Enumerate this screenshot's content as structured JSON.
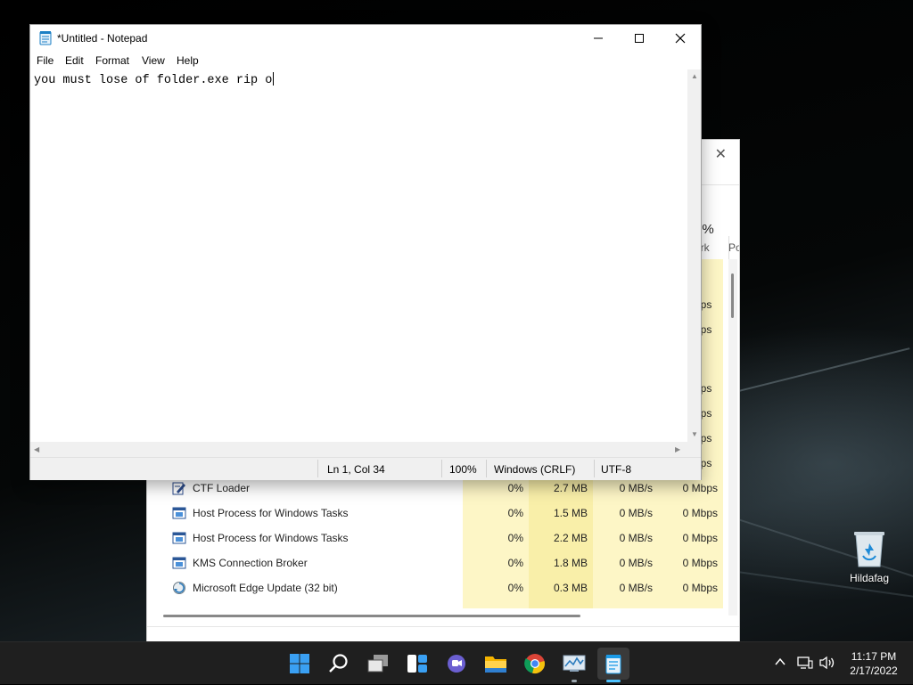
{
  "desktop": {
    "icons": [
      {
        "label": "Hildafag",
        "icon": "recycle-bin-icon"
      }
    ]
  },
  "notepad": {
    "title": "*Untitled - Notepad",
    "menu": [
      "File",
      "Edit",
      "Format",
      "View",
      "Help"
    ],
    "content": "you must lose of folder.exe rip o",
    "status": {
      "position": "Ln 1, Col 34",
      "zoom": "100%",
      "line_ending": "Windows (CRLF)",
      "encoding": "UTF-8"
    }
  },
  "task_manager": {
    "header": {
      "percent_fragment": "0%",
      "network_fragment": "ork",
      "power_fragment": "Po"
    },
    "partial_mbps": [
      "bps",
      "bps",
      "bps",
      "bps",
      "bps",
      "bps"
    ],
    "rows": [
      {
        "name": "CTF Loader",
        "icon": "ctf-loader-icon",
        "cpu": "0%",
        "memory": "2.7 MB",
        "disk": "0 MB/s",
        "network": "0 Mbps"
      },
      {
        "name": "Host Process for Windows Tasks",
        "icon": "host-process-icon",
        "cpu": "0%",
        "memory": "1.5 MB",
        "disk": "0 MB/s",
        "network": "0 Mbps"
      },
      {
        "name": "Host Process for Windows Tasks",
        "icon": "host-process-icon",
        "cpu": "0%",
        "memory": "2.2 MB",
        "disk": "0 MB/s",
        "network": "0 Mbps"
      },
      {
        "name": "KMS Connection Broker",
        "icon": "service-icon",
        "cpu": "0%",
        "memory": "1.8 MB",
        "disk": "0 MB/s",
        "network": "0 Mbps"
      },
      {
        "name": "Microsoft Edge Update (32 bit)",
        "icon": "edge-update-icon",
        "cpu": "0%",
        "memory": "0.3 MB",
        "disk": "0 MB/s",
        "network": "0 Mbps"
      }
    ]
  },
  "taskbar": {
    "apps": [
      "start-icon",
      "search-icon",
      "task-view-icon",
      "widgets-icon",
      "chat-icon",
      "file-explorer-icon",
      "chrome-icon",
      "task-manager-icon",
      "notepad-icon"
    ],
    "time": "11:17 PM",
    "date": "2/17/2022"
  },
  "colors": {
    "taskbar_bg": "#1f1f1f",
    "heat_light": "#fdf6c6",
    "heat_dark": "#f9efa9",
    "accent": "#0078d4"
  }
}
